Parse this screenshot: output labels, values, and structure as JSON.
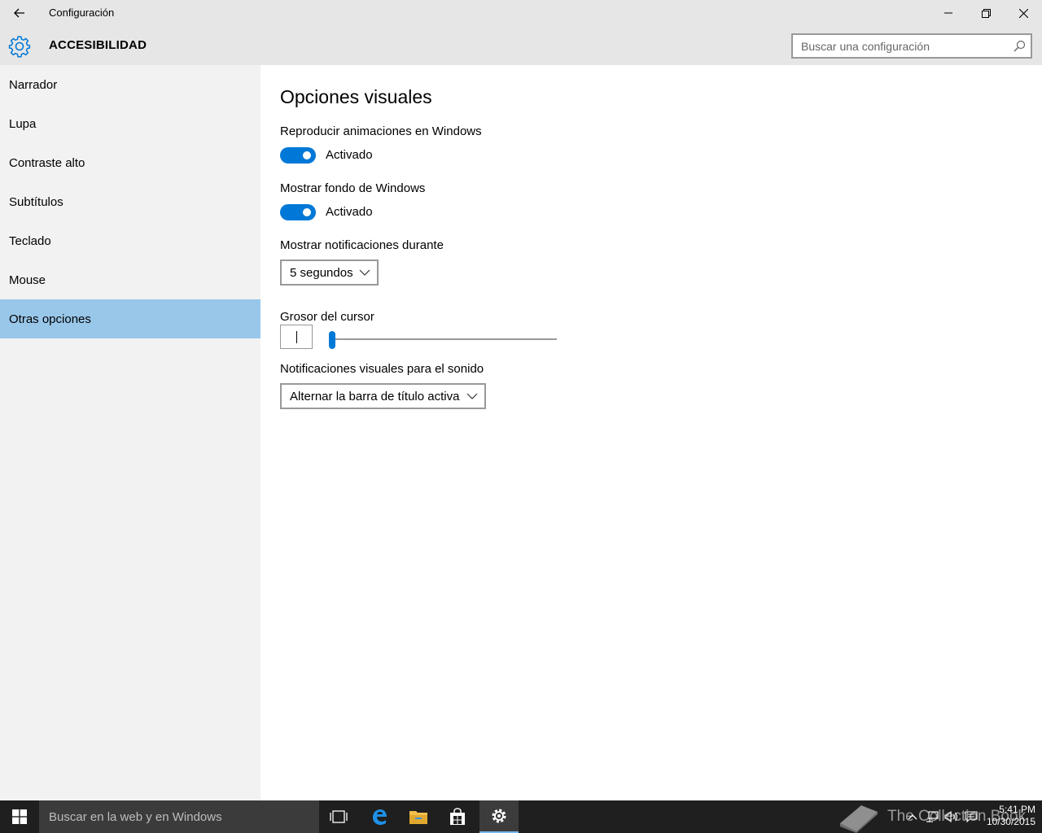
{
  "window": {
    "title": "Configuración",
    "back_icon": "arrow-left-icon",
    "controls": [
      "minimize-icon",
      "restore-icon",
      "close-icon"
    ]
  },
  "header": {
    "icon": "gear-icon",
    "title": "ACCESIBILIDAD",
    "search_placeholder": "Buscar una configuración"
  },
  "sidebar": {
    "items": [
      {
        "label": "Narrador",
        "selected": false
      },
      {
        "label": "Lupa",
        "selected": false
      },
      {
        "label": "Contraste alto",
        "selected": false
      },
      {
        "label": "Subtítulos",
        "selected": false
      },
      {
        "label": "Teclado",
        "selected": false
      },
      {
        "label": "Mouse",
        "selected": false
      },
      {
        "label": "Otras opciones",
        "selected": true
      }
    ],
    "selected_color": "#99c7ea"
  },
  "main": {
    "title": "Opciones visuales",
    "animations": {
      "label": "Reproducir animaciones en Windows",
      "state": "Activado",
      "on": true
    },
    "background": {
      "label": "Mostrar fondo de Windows",
      "state": "Activado",
      "on": true
    },
    "notifications": {
      "label": "Mostrar notificaciones durante",
      "value": "5 segundos"
    },
    "cursor": {
      "label": "Grosor del cursor",
      "slider_level": 0
    },
    "sound": {
      "label": "Notificaciones visuales para el sonido",
      "value": "Alternar la barra de título activa"
    },
    "accent_color": "#0078d7"
  },
  "taskbar": {
    "search_text": "Buscar en la web y en Windows",
    "pinned": [
      "task-view-icon",
      "edge-icon",
      "file-explorer-icon",
      "store-icon",
      "settings-icon"
    ],
    "active": "settings-icon",
    "tray": [
      "chevron-up-icon",
      "network-icon",
      "volume-icon",
      "action-center-icon"
    ],
    "time": "5:41 PM",
    "date": "10/30/2015",
    "watermark": "The Collection Book"
  }
}
